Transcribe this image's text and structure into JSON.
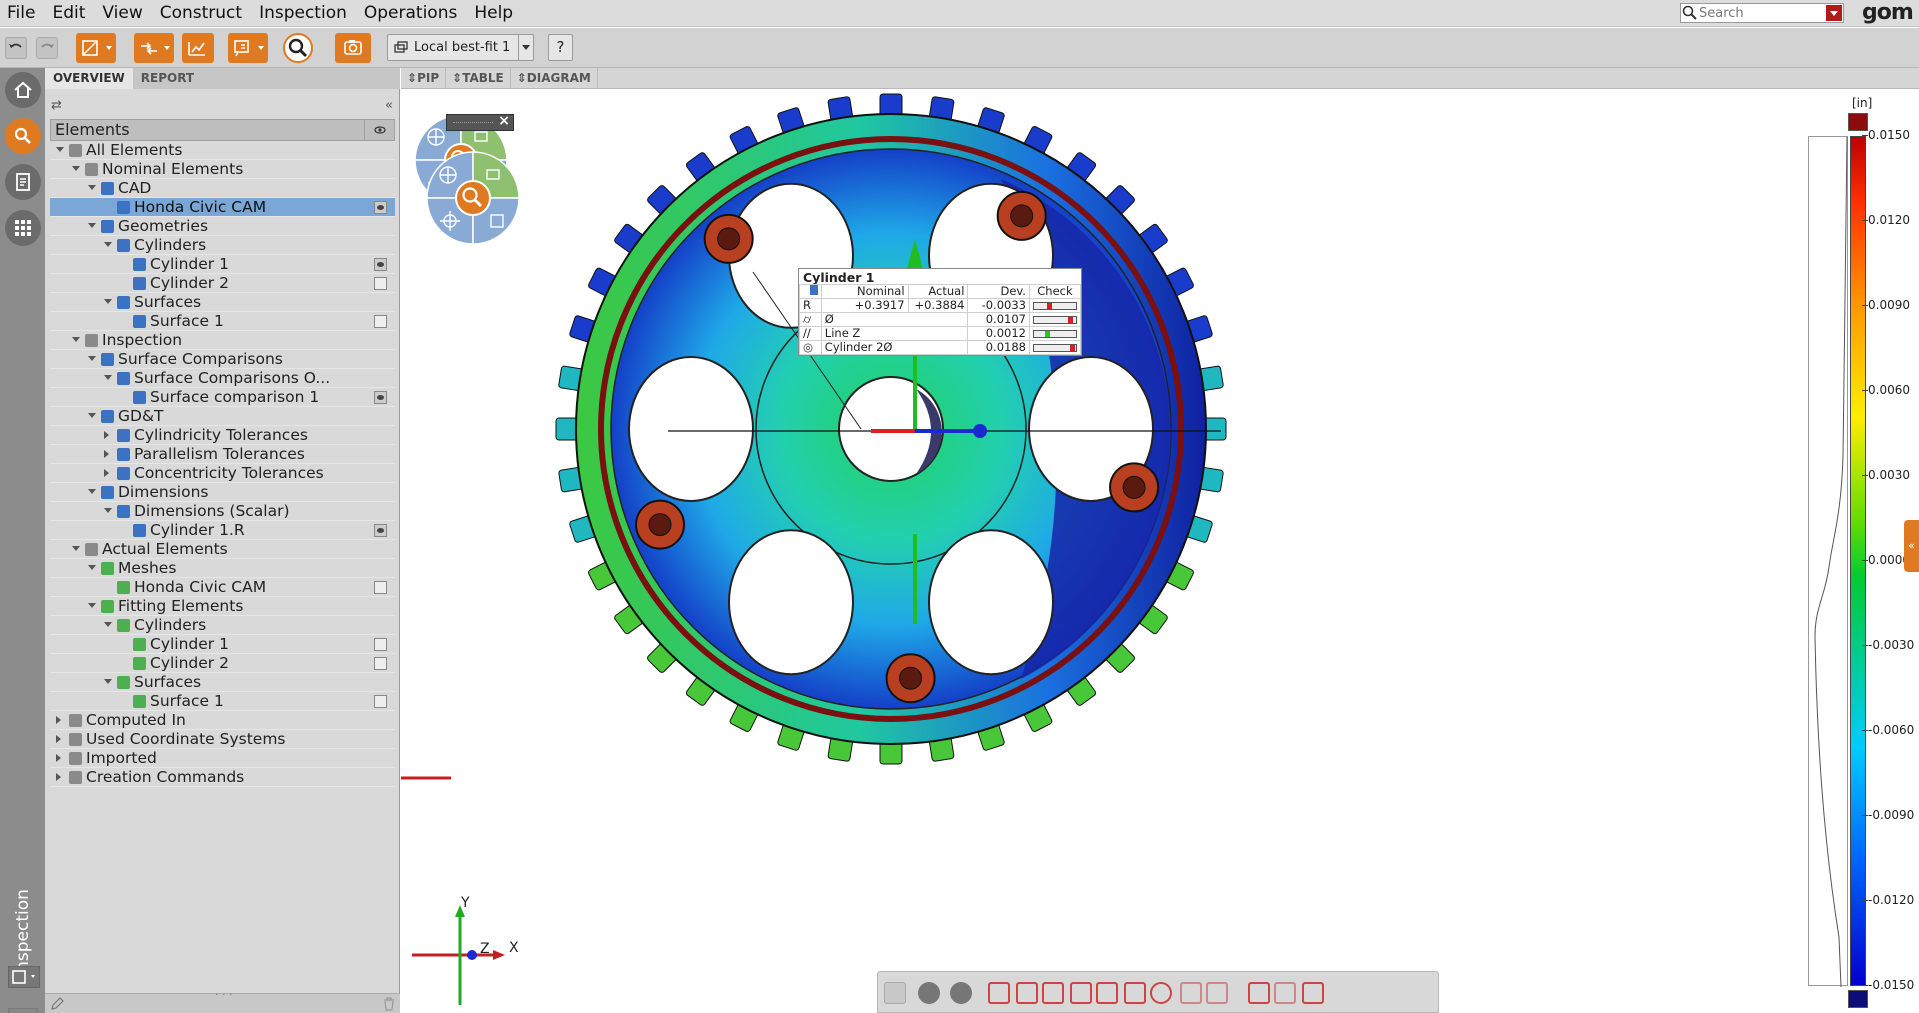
{
  "menu": [
    "File",
    "Edit",
    "View",
    "Construct",
    "Inspection",
    "Operations",
    "Help"
  ],
  "search": {
    "placeholder": "Search"
  },
  "logo": "gom",
  "toolbar": {
    "alignment": "Local best-fit 1",
    "help": "?"
  },
  "rail": {
    "label": "Inspection"
  },
  "explorer": {
    "tabs": [
      "OVERVIEW",
      "REPORT"
    ],
    "header": "Elements",
    "tree": [
      {
        "label": "All Elements",
        "level": 0,
        "state": "open",
        "icon": "folder-icon",
        "icon_color": "#8a8a8a"
      },
      {
        "label": "Nominal Elements",
        "level": 1,
        "state": "open",
        "icon": "folder-icon",
        "icon_color": "#8a8a8a"
      },
      {
        "label": "CAD",
        "level": 2,
        "state": "open",
        "icon": "cad-icon",
        "icon_color": "#3b72c4"
      },
      {
        "label": "Honda Civic CAM",
        "level": 3,
        "state": "none",
        "icon": "cad-part-icon",
        "icon_color": "#3b72c4",
        "visible": "on",
        "selected": true
      },
      {
        "label": "Geometries",
        "level": 2,
        "state": "open",
        "icon": "geometries-icon",
        "icon_color": "#3b72c4"
      },
      {
        "label": "Cylinders",
        "level": 3,
        "state": "open",
        "icon": "cylinders-icon",
        "icon_color": "#3b72c4"
      },
      {
        "label": "Cylinder 1",
        "level": 4,
        "state": "none",
        "icon": "cylinder-icon",
        "icon_color": "#3b72c4",
        "visible": "on"
      },
      {
        "label": "Cylinder 2",
        "level": 4,
        "state": "none",
        "icon": "cylinder-icon",
        "icon_color": "#3b72c4",
        "visible": "off"
      },
      {
        "label": "Surfaces",
        "level": 3,
        "state": "open",
        "icon": "surfaces-icon",
        "icon_color": "#3b72c4"
      },
      {
        "label": "Surface 1",
        "level": 4,
        "state": "none",
        "icon": "surface-icon",
        "icon_color": "#3b72c4",
        "visible": "off"
      },
      {
        "label": "Inspection",
        "level": 1,
        "state": "open",
        "icon": "folder-icon",
        "icon_color": "#8a8a8a"
      },
      {
        "label": "Surface Comparisons",
        "level": 2,
        "state": "open",
        "icon": "surface-comparisons-icon",
        "icon_color": "#3b72c4"
      },
      {
        "label": "Surface Comparisons O...",
        "level": 3,
        "state": "open",
        "icon": "surface-comparison-group-icon",
        "icon_color": "#3b72c4"
      },
      {
        "label": "Surface comparison 1",
        "level": 4,
        "state": "none",
        "icon": "surface-comparison-icon",
        "icon_color": "#3b72c4",
        "visible": "on"
      },
      {
        "label": "GD&T",
        "level": 2,
        "state": "open",
        "icon": "gdt-icon",
        "icon_color": "#3b72c4"
      },
      {
        "label": "Cylindricity Tolerances",
        "level": 3,
        "state": "closed",
        "icon": "cylindricity-icon",
        "icon_color": "#3b72c4"
      },
      {
        "label": "Parallelism Tolerances",
        "level": 3,
        "state": "closed",
        "icon": "parallelism-icon",
        "icon_color": "#3b72c4"
      },
      {
        "label": "Concentricity Tolerances",
        "level": 3,
        "state": "closed",
        "icon": "concentricity-icon",
        "icon_color": "#3b72c4"
      },
      {
        "label": "Dimensions",
        "level": 2,
        "state": "open",
        "icon": "dimensions-icon",
        "icon_color": "#3b72c4"
      },
      {
        "label": "Dimensions (Scalar)",
        "level": 3,
        "state": "open",
        "icon": "dimensions-scalar-icon",
        "icon_color": "#3b72c4"
      },
      {
        "label": "Cylinder 1.R",
        "level": 4,
        "state": "none",
        "icon": "radius-icon",
        "icon_color": "#3b72c4",
        "visible": "on"
      },
      {
        "label": "Actual Elements",
        "level": 1,
        "state": "open",
        "icon": "folder-icon",
        "icon_color": "#8a8a8a"
      },
      {
        "label": "Meshes",
        "level": 2,
        "state": "open",
        "icon": "meshes-icon",
        "icon_color": "#4caf50"
      },
      {
        "label": "Honda Civic CAM",
        "level": 3,
        "state": "none",
        "icon": "mesh-icon",
        "icon_color": "#4caf50",
        "visible": "off"
      },
      {
        "label": "Fitting Elements",
        "level": 2,
        "state": "open",
        "icon": "fitting-icon",
        "icon_color": "#4caf50"
      },
      {
        "label": "Cylinders",
        "level": 3,
        "state": "open",
        "icon": "cylinders-icon",
        "icon_color": "#4caf50"
      },
      {
        "label": "Cylinder 1",
        "level": 4,
        "state": "none",
        "icon": "cylinder-icon",
        "icon_color": "#4caf50",
        "visible": "off"
      },
      {
        "label": "Cylinder 2",
        "level": 4,
        "state": "none",
        "icon": "cylinder-icon",
        "icon_color": "#4caf50",
        "visible": "off"
      },
      {
        "label": "Surfaces",
        "level": 3,
        "state": "open",
        "icon": "surfaces-icon",
        "icon_color": "#4caf50"
      },
      {
        "label": "Surface 1",
        "level": 4,
        "state": "none",
        "icon": "surface-icon",
        "icon_color": "#4caf50",
        "visible": "off"
      },
      {
        "label": "Computed In",
        "level": 0,
        "state": "closed",
        "icon": "folder-icon",
        "icon_color": "#8a8a8a"
      },
      {
        "label": "Used Coordinate Systems",
        "level": 0,
        "state": "closed",
        "icon": "folder-icon",
        "icon_color": "#8a8a8a"
      },
      {
        "label": "Imported",
        "level": 0,
        "state": "closed",
        "icon": "folder-icon",
        "icon_color": "#8a8a8a"
      },
      {
        "label": "Creation Commands",
        "level": 0,
        "state": "closed",
        "icon": "folder-icon",
        "icon_color": "#8a8a8a"
      }
    ]
  },
  "viewtabs": [
    "PIP",
    "TABLE",
    "DIAGRAM"
  ],
  "label_box": {
    "title": "Cylinder 1",
    "headers": [
      "",
      "Nominal",
      "Actual",
      "Dev.",
      "Check"
    ],
    "rows": [
      {
        "sym": "R",
        "name": "",
        "nominal": "+0.3917",
        "actual": "+0.3884",
        "dev": "-0.0033",
        "check": 0.35,
        "check_color": "#d92020"
      },
      {
        "sym": "⌭",
        "name": "Ø",
        "nominal": "",
        "actual": "",
        "dev": "0.0107",
        "check": 0.9,
        "check_color": "#d92020"
      },
      {
        "sym": "//",
        "name": "Line Z",
        "nominal": "",
        "actual": "",
        "dev": "0.0012",
        "check": 0.3,
        "check_color": "#22cc22"
      },
      {
        "sym": "◎",
        "name": "Cylinder 2Ø",
        "nominal": "",
        "actual": "",
        "dev": "0.0188",
        "check": 0.95,
        "check_color": "#d92020"
      }
    ]
  },
  "legend": {
    "unit": "[in]",
    "ticks": [
      "0.0150",
      "0.0120",
      "0.0090",
      "0.0060",
      "0.0030",
      "0.0000",
      "-0.0030",
      "-0.0060",
      "-0.0090",
      "-0.0120",
      "-0.0150"
    ],
    "max_color": "#8b0c0c",
    "min_color": "#0d0d7a"
  },
  "axes": {
    "x": "X",
    "y": "Y",
    "z": "Z"
  },
  "colors": {
    "accent": "#e07a20",
    "selection": "#7aa7d6"
  }
}
